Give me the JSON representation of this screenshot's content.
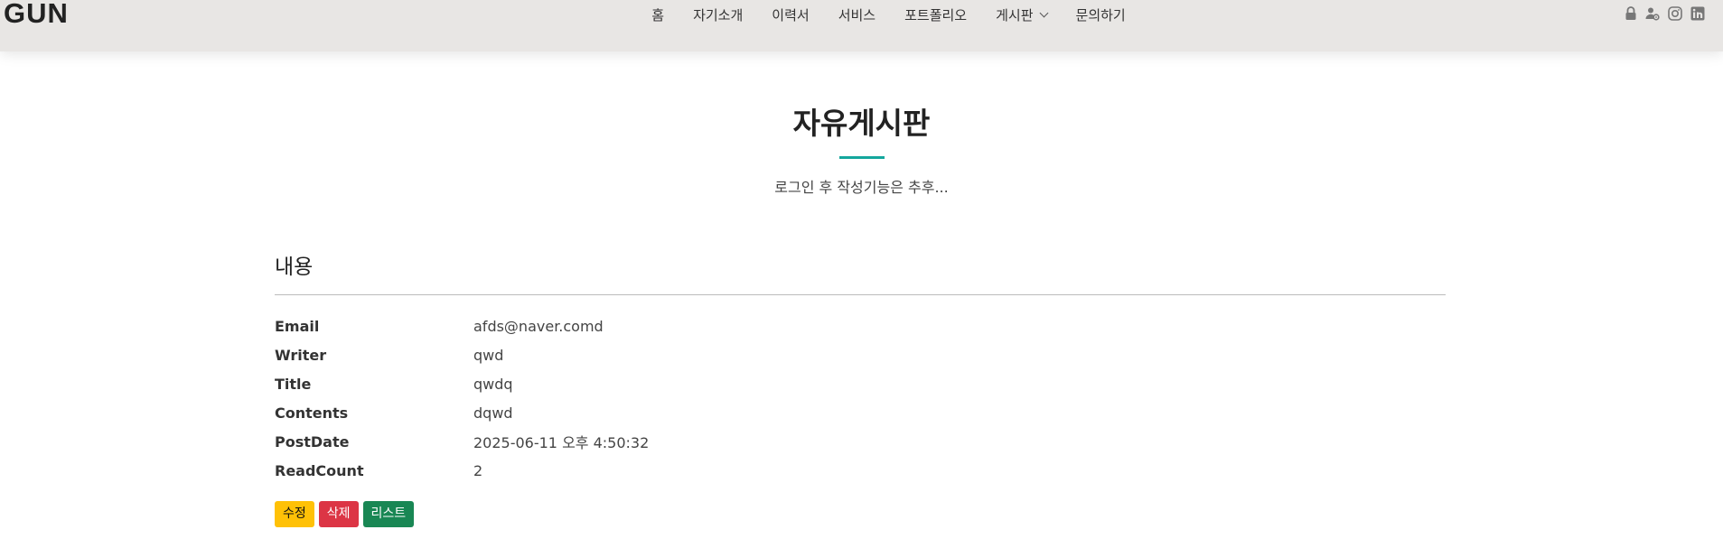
{
  "header": {
    "logo": "GUN",
    "nav": [
      "홈",
      "자기소개",
      "이력서",
      "서비스",
      "포트폴리오",
      "게시판",
      "문의하기"
    ],
    "social": [
      "lock-icon",
      "user-gear-icon",
      "instagram-icon",
      "linkedin-icon"
    ]
  },
  "section": {
    "title": "자유게시판",
    "subtitle": "로그인 후 작성기능은 추후..."
  },
  "detail": {
    "heading": "내용",
    "rows": [
      {
        "label": "Email",
        "value": "afds@naver.comd"
      },
      {
        "label": "Writer",
        "value": "qwd"
      },
      {
        "label": "Title",
        "value": "qwdq"
      },
      {
        "label": "Contents",
        "value": "dqwd"
      },
      {
        "label": "PostDate",
        "value": "2025-06-11 오후 4:50:32"
      },
      {
        "label": "ReadCount",
        "value": "2"
      }
    ]
  },
  "buttons": {
    "edit": "수정",
    "delete": "삭제",
    "list": "리스트"
  },
  "colors": {
    "accent": "#14a79d",
    "edit": "#ffc107",
    "delete": "#dc3545",
    "list": "#198754"
  }
}
